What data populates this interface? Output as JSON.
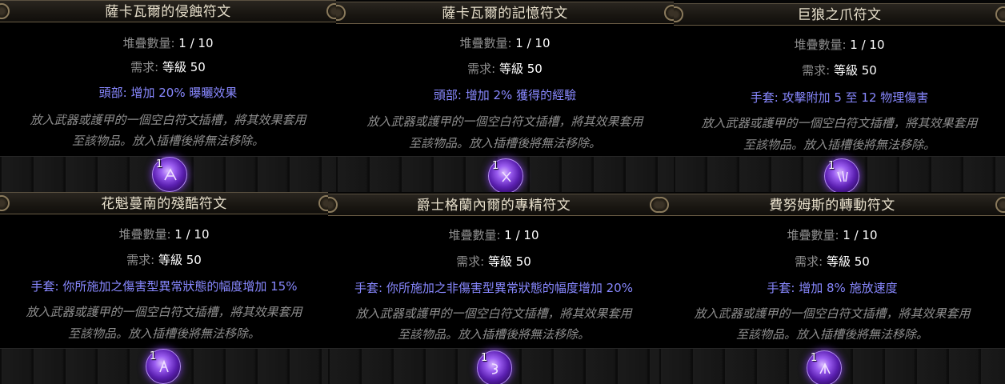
{
  "cards": [
    {
      "title": "薩卡瓦爾的侵蝕符文",
      "stack_label": "堆疊數量: ",
      "stack_value": "1 / 10",
      "req_label": "需求: ",
      "req_value": "等級 50",
      "mod": "頭部: 增加 20% 曝曬效果",
      "desc1": "放入武器或護甲的一個空白符文插槽，將其效果套用",
      "desc2": "至該物品。放入插槽後將無法移除。",
      "count": "1",
      "rune_icon": "rune-orb-icon"
    },
    {
      "title": "薩卡瓦爾的記憶符文",
      "stack_label": "堆疊數量: ",
      "stack_value": "1 / 10",
      "req_label": "需求: ",
      "req_value": "等級 50",
      "mod": "頭部: 增加 2% 獲得的經驗",
      "desc1": "放入武器或護甲的一個空白符文插槽，將其效果套用",
      "desc2": "至該物品。放入插槽後將無法移除。",
      "count": "1",
      "rune_icon": "rune-orb-icon"
    },
    {
      "title": "巨狼之爪符文",
      "stack_label": "堆疊數量: ",
      "stack_value": "1 / 10",
      "req_label": "需求: ",
      "req_value": "等級 50",
      "mod": "手套: 攻擊附加 5 至 12 物理傷害",
      "desc1": "放入武器或護甲的一個空白符文插槽，將其效果套用",
      "desc2": "至該物品。放入插槽後將無法移除。",
      "count": "1",
      "rune_icon": "rune-orb-icon"
    },
    {
      "title": "花魁蔓南的殘酷符文",
      "stack_label": "堆疊數量: ",
      "stack_value": "1 / 10",
      "req_label": "需求: ",
      "req_value": "等級 50",
      "mod": "手套: 你所施加之傷害型異常狀態的幅度增加 15%",
      "desc1": "放入武器或護甲的一個空白符文插槽，將其效果套用",
      "desc2": "至該物品。放入插槽後將無法移除。",
      "count": "1",
      "rune_icon": "rune-orb-icon"
    },
    {
      "title": "爵士格蘭內爾的專精符文",
      "stack_label": "堆疊數量: ",
      "stack_value": "1 / 10",
      "req_label": "需求: ",
      "req_value": "等級 50",
      "mod": "手套: 你所施加之非傷害型異常狀態的幅度增加 20%",
      "desc1": "放入武器或護甲的一個空白符文插槽，將其效果套用",
      "desc2": "至該物品。放入插槽後將無法移除。",
      "count": "1",
      "rune_icon": "rune-orb-icon"
    },
    {
      "title": "費努姆斯的轉動符文",
      "stack_label": "堆疊數量: ",
      "stack_value": "1 / 10",
      "req_label": "需求: ",
      "req_value": "等級 50",
      "mod": "手套: 增加 8% 施放速度",
      "desc1": "放入武器或護甲的一個空白符文插槽，將其效果套用",
      "desc2": "至該物品。放入插槽後將無法移除。",
      "count": "1",
      "rune_icon": "rune-orb-icon"
    }
  ]
}
